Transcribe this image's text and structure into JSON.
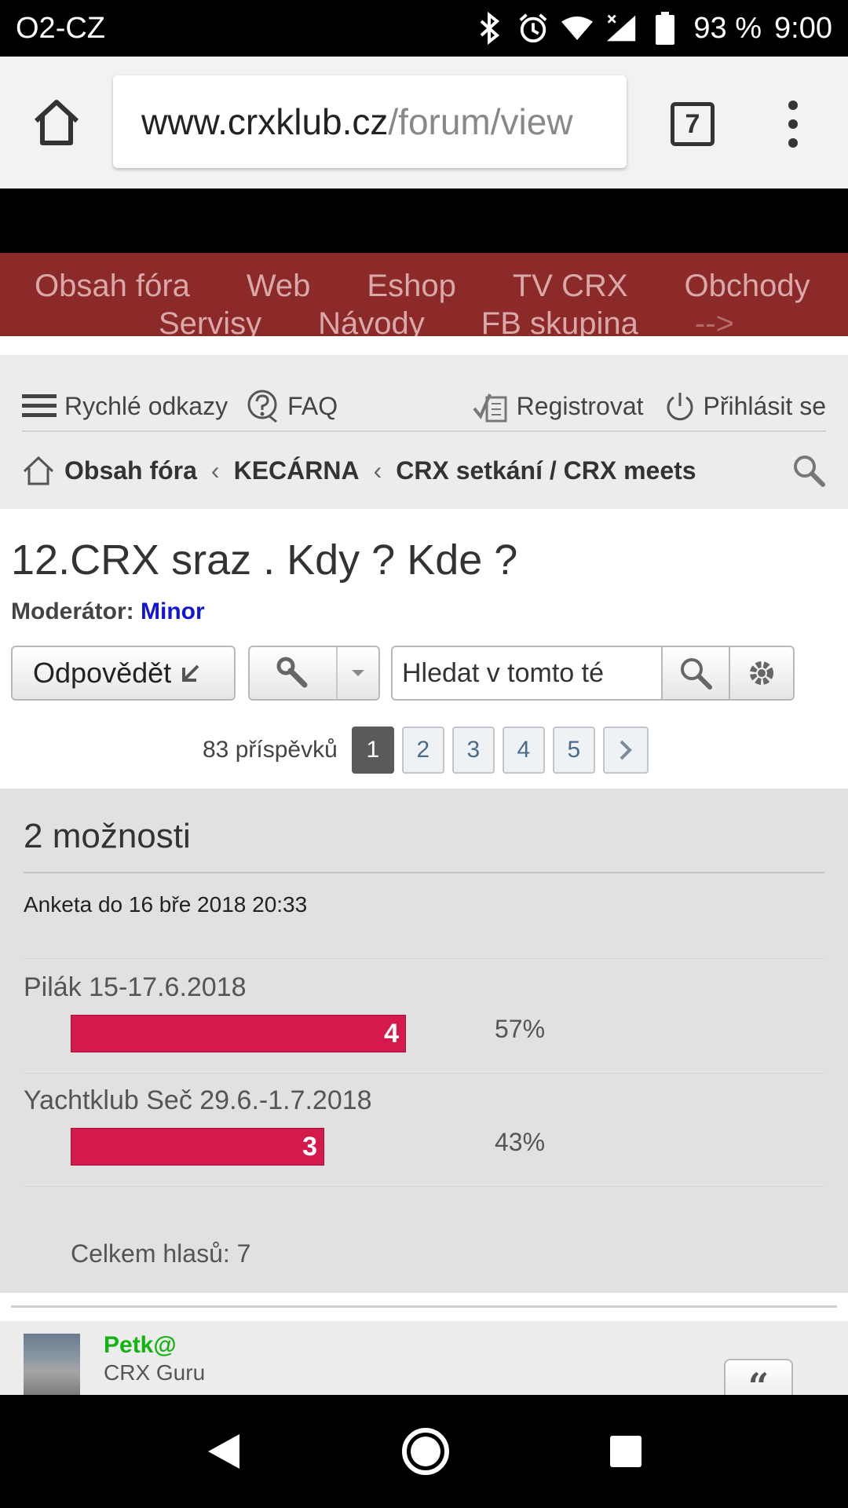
{
  "status_bar": {
    "carrier": "O2-CZ",
    "battery": "93 %",
    "time": "9:00"
  },
  "browser": {
    "url_host": "www.crxklub.cz",
    "url_path": "/forum/view",
    "tab_count": "7"
  },
  "site_nav": {
    "row1": [
      "Obsah fóra",
      "Web",
      "Eshop",
      "TV CRX",
      "Obchody"
    ],
    "row2": [
      "Servisy",
      "Návody",
      "FB skupina",
      "-->"
    ]
  },
  "quick_links": {
    "quick": "Rychlé odkazy",
    "faq": "FAQ",
    "register": "Registrovat",
    "login": "Přihlásit se"
  },
  "breadcrumbs": [
    "Obsah fóra",
    "KECÁRNA",
    "CRX setkání / CRX meets"
  ],
  "breadcrumb_sep": "‹",
  "topic": {
    "title": "12.CRX sraz . Kdy ? Kde ?",
    "moderator_label": "Moderátor:",
    "moderator_name": "Minor"
  },
  "actions": {
    "reply_label": "Odpovědět",
    "search_value": "Hledat v tomto té"
  },
  "pagination": {
    "count_text": "83 příspěvků",
    "pages": [
      "1",
      "2",
      "3",
      "4",
      "5"
    ],
    "active_page": "1"
  },
  "poll": {
    "title": "2 možnosti",
    "end_text": "Anketa do 16 bře 2018 20:33",
    "options": [
      {
        "label": "Pilák 15-17.6.2018",
        "votes": "4",
        "percent": "57%",
        "fraction": 0.57
      },
      {
        "label": "Yachtklub Seč 29.6.-1.7.2018",
        "votes": "3",
        "percent": "43%",
        "fraction": 0.43
      }
    ],
    "total_text": "Celkem hlasů: 7",
    "bar_color": "#d41a4c"
  },
  "post": {
    "author": "Petk@",
    "rank": "CRX Guru",
    "quote_label": "“"
  },
  "colors": {
    "nav_band": "#8c2a2a",
    "moderator": "#1414d4",
    "author": "#13b313"
  }
}
